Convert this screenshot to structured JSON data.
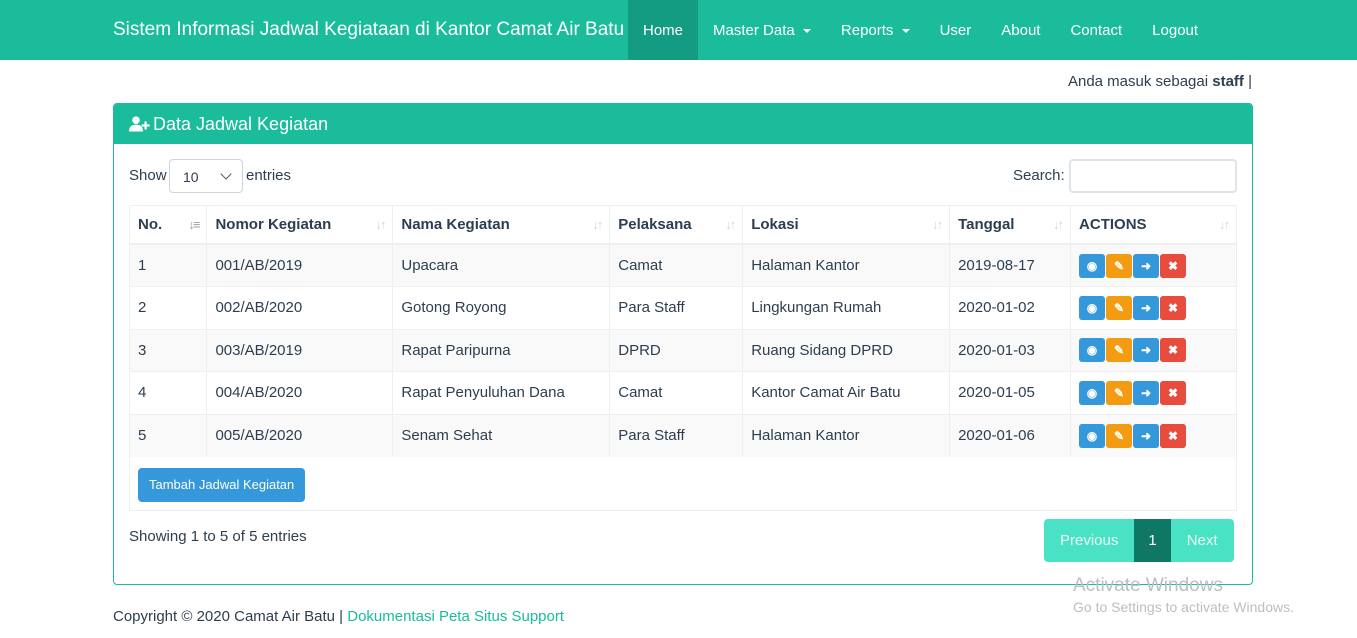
{
  "navbar": {
    "brand": "Sistem Informasi Jadwal Kegiataan di Kantor Camat Air Batu",
    "items": [
      {
        "label": "Home",
        "active": true,
        "dropdown": false
      },
      {
        "label": "Master Data",
        "active": false,
        "dropdown": true
      },
      {
        "label": "Reports",
        "active": false,
        "dropdown": true
      },
      {
        "label": "User",
        "active": false,
        "dropdown": false
      },
      {
        "label": "About",
        "active": false,
        "dropdown": false
      },
      {
        "label": "Contact",
        "active": false,
        "dropdown": false
      },
      {
        "label": "Logout",
        "active": false,
        "dropdown": false
      }
    ]
  },
  "login": {
    "prefix": "Anda masuk sebagai",
    "user": "staff",
    "suffix": "|"
  },
  "panel": {
    "title": "Data Jadwal Kegiatan",
    "icon": "user-plus-icon"
  },
  "length": {
    "label": "Show",
    "value": "10",
    "suffix": "entries"
  },
  "search": {
    "label": "Search:",
    "value": ""
  },
  "table": {
    "columns": [
      "No.",
      "Nomor Kegiatan",
      "Nama Kegiatan",
      "Pelaksana",
      "Lokasi",
      "Tanggal",
      "ACTIONS"
    ],
    "rows": [
      [
        "1",
        "001/AB/2019",
        "Upacara",
        "Camat",
        "Halaman Kantor",
        "2019-08-17"
      ],
      [
        "2",
        "002/AB/2020",
        "Gotong Royong",
        "Para Staff",
        "Lingkungan Rumah",
        "2020-01-02"
      ],
      [
        "3",
        "003/AB/2019",
        "Rapat Paripurna",
        "DPRD",
        "Ruang Sidang DPRD",
        "2020-01-03"
      ],
      [
        "4",
        "004/AB/2020",
        "Rapat Penyuluhan Dana",
        "Camat",
        "Kantor Camat Air Batu",
        "2020-01-05"
      ],
      [
        "5",
        "005/AB/2020",
        "Senam Sehat",
        "Para Staff",
        "Halaman Kantor",
        "2020-01-06"
      ]
    ],
    "actions": [
      "view-icon",
      "edit-icon",
      "arrow-right-icon",
      "delete-icon"
    ]
  },
  "add_button": "Tambah Jadwal Kegiatan",
  "info": "Showing 1 to 5 of 5 entries",
  "pagination": {
    "prev": "Previous",
    "current": "1",
    "next": "Next"
  },
  "watermark": {
    "title": "Activate Windows",
    "subtitle": "Go to Settings to activate Windows."
  },
  "footer": {
    "text": "Copyright © 2020 Camat Air Batu |",
    "links": "Dokumentasi Peta Situs Support"
  },
  "colors": {
    "primary": "#1abc9c",
    "active_nav": "#149c82",
    "info": "#3498db",
    "warning": "#f39c12",
    "danger": "#e74c3c"
  }
}
